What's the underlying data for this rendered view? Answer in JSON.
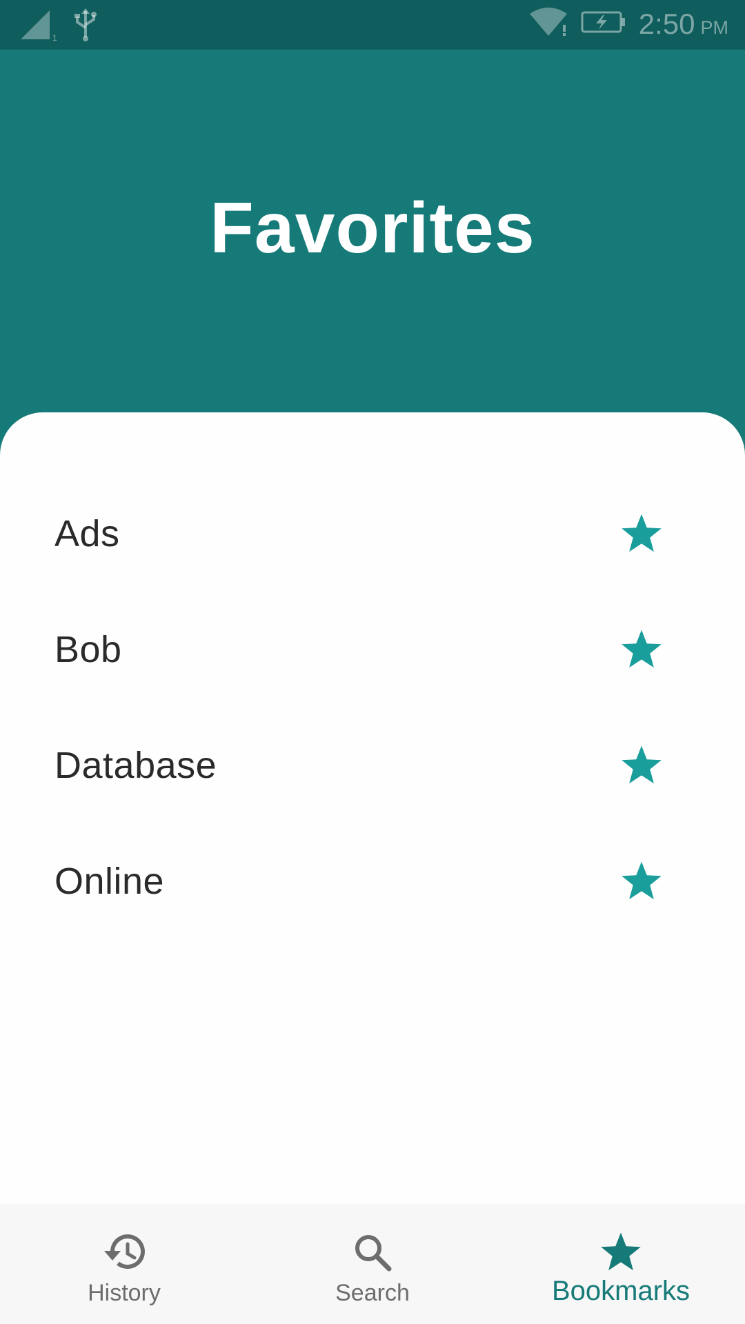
{
  "status_bar": {
    "time": "2:50",
    "ampm": "PM",
    "icons": [
      "signal-icon",
      "usb-icon",
      "wifi-icon",
      "battery-charging-icon"
    ]
  },
  "header": {
    "title": "Favorites"
  },
  "favorites": {
    "items": [
      {
        "label": "Ads",
        "icon": "star-icon"
      },
      {
        "label": "Bob",
        "icon": "star-icon"
      },
      {
        "label": "Database",
        "icon": "star-icon"
      },
      {
        "label": "Online",
        "icon": "star-icon"
      }
    ]
  },
  "bottom_nav": {
    "items": [
      {
        "label": "History",
        "icon": "history-icon",
        "active": false
      },
      {
        "label": "Search",
        "icon": "search-icon",
        "active": false
      },
      {
        "label": "Bookmarks",
        "icon": "star-icon",
        "active": true
      }
    ]
  },
  "colors": {
    "primary": "#167a78",
    "status_bar": "#0f5d5c",
    "star": "#1a9e9c",
    "text": "#2a2a2a",
    "nav_inactive": "#6d6d6d",
    "nav_background": "#f7f7f7"
  }
}
